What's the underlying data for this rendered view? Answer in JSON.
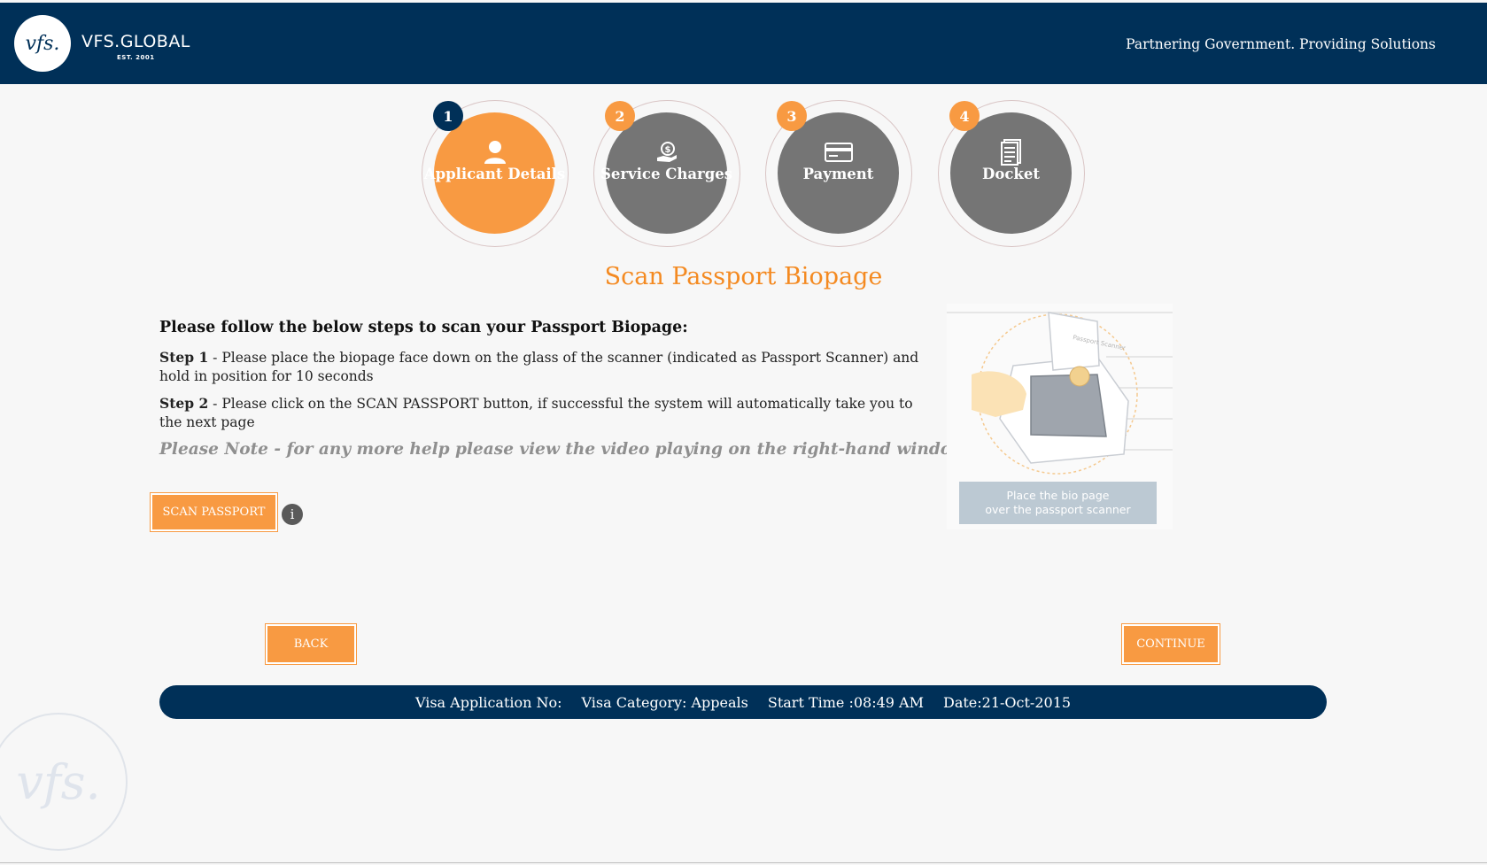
{
  "header": {
    "logo_text": "vfs.",
    "brand": "VFS.GLOBAL",
    "brand_sub": "EST. 2001",
    "tagline": "Partnering Government. Providing Solutions"
  },
  "steps": [
    {
      "number": "1",
      "label": "Applicant Details",
      "icon": "person-icon",
      "active": true
    },
    {
      "number": "2",
      "label": "Service Charges",
      "icon": "money-hand-icon",
      "active": false
    },
    {
      "number": "3",
      "label": "Payment",
      "icon": "card-icon",
      "active": false
    },
    {
      "number": "4",
      "label": "Docket",
      "icon": "document-icon",
      "active": false
    }
  ],
  "page_title": "Scan Passport Biopage",
  "instructions": {
    "heading": "Please follow the below steps to scan your Passport Biopage:",
    "step1_label": "Step 1",
    "step1_text": " - Please place the biopage face down on the glass of the scanner (indicated as Passport Scanner) and hold in position for 10 seconds",
    "step2_label": "Step 2",
    "step2_text": " - Please click on the SCAN PASSPORT button, if successful the system will automatically take you to the next page",
    "note": "Please Note - for any more help please view the video playing on the right-hand window"
  },
  "scan_button": "SCAN PASSPORT",
  "info_icon_glyph": "i",
  "video": {
    "caption_line1": "Place the bio page",
    "caption_line2": "over the passport scanner",
    "scanner_label": "Passport Scanner"
  },
  "nav": {
    "back": "BACK",
    "continue": "CONTINUE"
  },
  "info_bar": {
    "application_no": "Visa Application No:",
    "category": "Visa Category: Appeals",
    "start_time": "Start Time :08:49 AM",
    "date": "Date:21-Oct-2015"
  },
  "watermark_text": "vfs.",
  "colors": {
    "navy": "#003058",
    "orange": "#f89a42",
    "title_orange": "#f48a21",
    "inactive_grey": "#757575"
  }
}
